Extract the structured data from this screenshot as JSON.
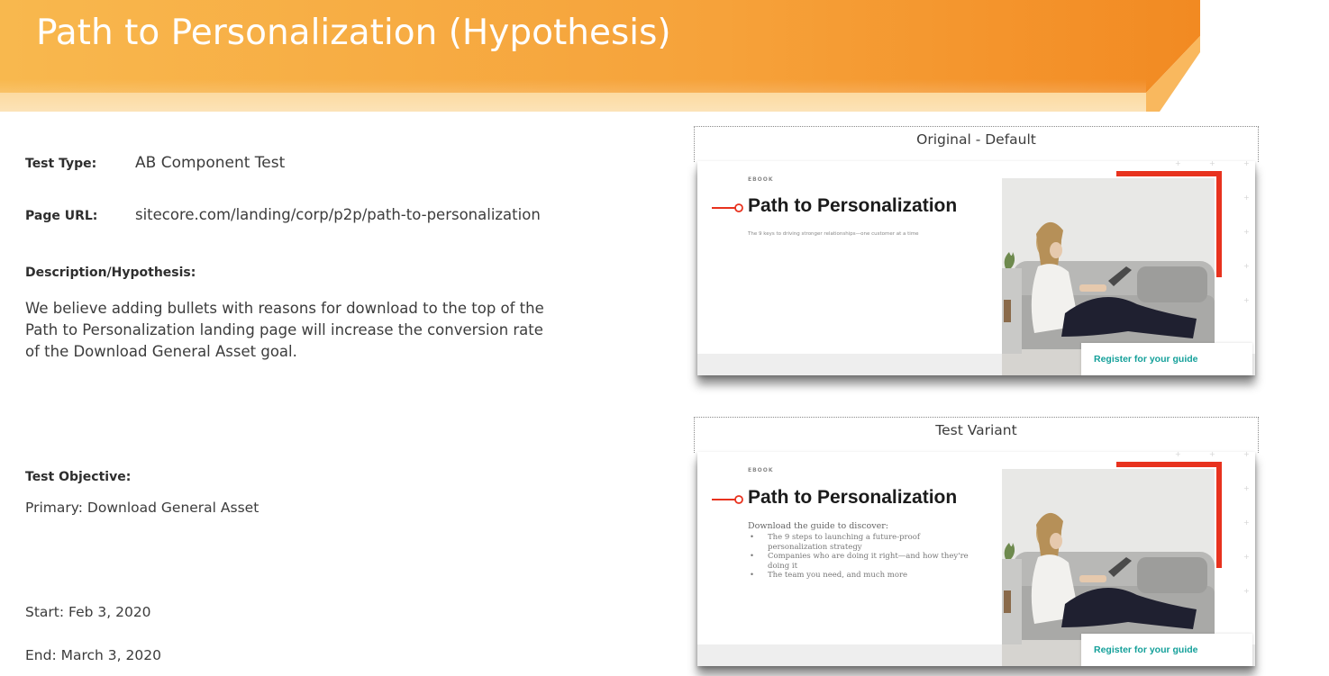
{
  "header": {
    "title": "Path to Personalization (Hypothesis)"
  },
  "colors": {
    "banner_start": "#f7b24a",
    "banner_end": "#f28a22",
    "accent_red": "#e8321e",
    "register_teal": "#14a09a"
  },
  "test_type": {
    "label": "Test Type:",
    "value": "AB Component Test"
  },
  "page_url": {
    "label": "Page URL:",
    "value": "sitecore.com/landing/corp/p2p/path-to-personalization"
  },
  "description": {
    "label": "Description/Hypothesis:",
    "lines": [
      "We believe adding bullets with reasons for download to the top of the",
      "Path to Personalization landing page will increase the conversion rate",
      "of the Download General Asset goal."
    ]
  },
  "objective": {
    "label": "Test Objective:",
    "value": "Primary: Download General Asset"
  },
  "dates": {
    "start": "Start: Feb 3, 2020",
    "end": "End: March 3, 2020"
  },
  "original": {
    "frame_label": "Original - Default",
    "eyebrow": "EBOOK",
    "title": "Path to Personalization",
    "subtitle": "The 9 keys to driving stronger relationships—one customer at a time",
    "cta": "Register for your guide"
  },
  "variant": {
    "frame_label": "Test Variant",
    "eyebrow": "EBOOK",
    "title": "Path to Personalization",
    "intro": "Download the guide to discover:",
    "bullets": [
      "The 9 steps to launching a future-proof personalization strategy",
      "Companies who are doing it right—and how they're doing it",
      "The team you need, and much more"
    ],
    "cta": "Register for your guide"
  }
}
